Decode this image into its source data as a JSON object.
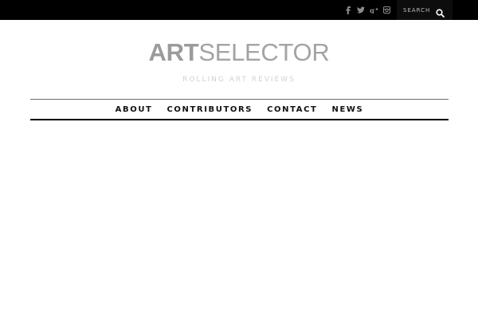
{
  "topbar": {
    "social": [
      {
        "name": "facebook-icon",
        "glyph": "f"
      },
      {
        "name": "twitter-icon",
        "glyph": "t"
      },
      {
        "name": "google-plus-icon",
        "glyph": "g+"
      },
      {
        "name": "instagram-icon",
        "glyph": "ig"
      }
    ],
    "search": {
      "placeholder": "SEARCH"
    }
  },
  "header": {
    "logo_bold": "ART",
    "logo_light": "SELECTOR",
    "tagline": "ROLLING ART REVIEWS"
  },
  "nav": {
    "items": [
      "ABOUT",
      "CONTRIBUTORS",
      "CONTACT",
      "NEWS"
    ]
  },
  "colors": {
    "topbar": "#000000",
    "logo": "#9b9b9b",
    "tagline": "#d2d2d2",
    "nav_text": "#111111"
  }
}
